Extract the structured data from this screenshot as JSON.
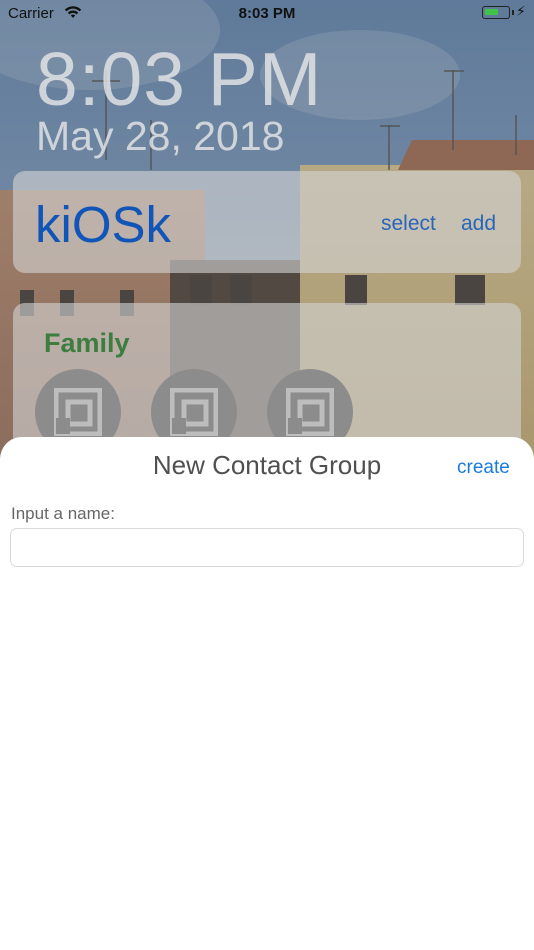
{
  "status_bar": {
    "carrier": "Carrier",
    "time": "8:03 PM",
    "battery_level": 0.6,
    "wifi_icon": "wifi-icon",
    "charging_icon": "bolt-icon"
  },
  "lockscreen": {
    "time": "8:03 PM",
    "date": "May 28, 2018"
  },
  "header": {
    "brand": "kiOSk",
    "select_label": "select",
    "add_label": "add",
    "accent_color": "#1155b8"
  },
  "group": {
    "name": "Family",
    "name_color": "#3d7d3f",
    "contacts": [
      {
        "icon": "contact-placeholder-icon"
      },
      {
        "icon": "contact-placeholder-icon"
      },
      {
        "icon": "contact-placeholder-icon"
      }
    ]
  },
  "sheet": {
    "title": "New Contact Group",
    "create_label": "create",
    "input_label": "Input a name:",
    "input_value": "",
    "input_placeholder": "",
    "link_color": "#1a7bde"
  }
}
